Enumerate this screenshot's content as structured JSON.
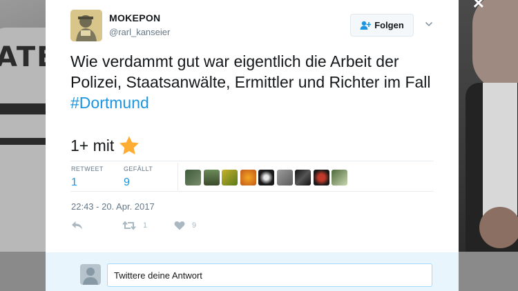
{
  "tweet": {
    "display_name": "MOKEPON",
    "handle": "@rarl_kanseier",
    "follow_label": "Folgen",
    "text_main": "Wie verdammt gut war eigentlich die Arbeit der Polizei, Staatsanwälte, Ermittler und Richter im Fall ",
    "hashtag": "#Dortmund",
    "second_line": "1+ mit",
    "second_line_icon": "star-icon",
    "stats": {
      "retweets_label": "RETWEET",
      "retweets_value": "1",
      "likes_label": "GEFÄLLT",
      "likes_value": "9"
    },
    "liker_avatar_count": 9,
    "timestamp": "22:43 - 20. Apr. 2017",
    "actions": {
      "reply_icon": "reply-icon",
      "retweet_icon": "retweet-icon",
      "retweet_count": "1",
      "like_icon": "heart-icon",
      "like_count": "9"
    }
  },
  "reply_box": {
    "placeholder": "Twittere deine Antwort"
  },
  "colors": {
    "link": "#1b95e0",
    "text": "#14171a",
    "muted": "#657786",
    "star": "#ffac33",
    "reply_background": "#e8f5fd"
  }
}
